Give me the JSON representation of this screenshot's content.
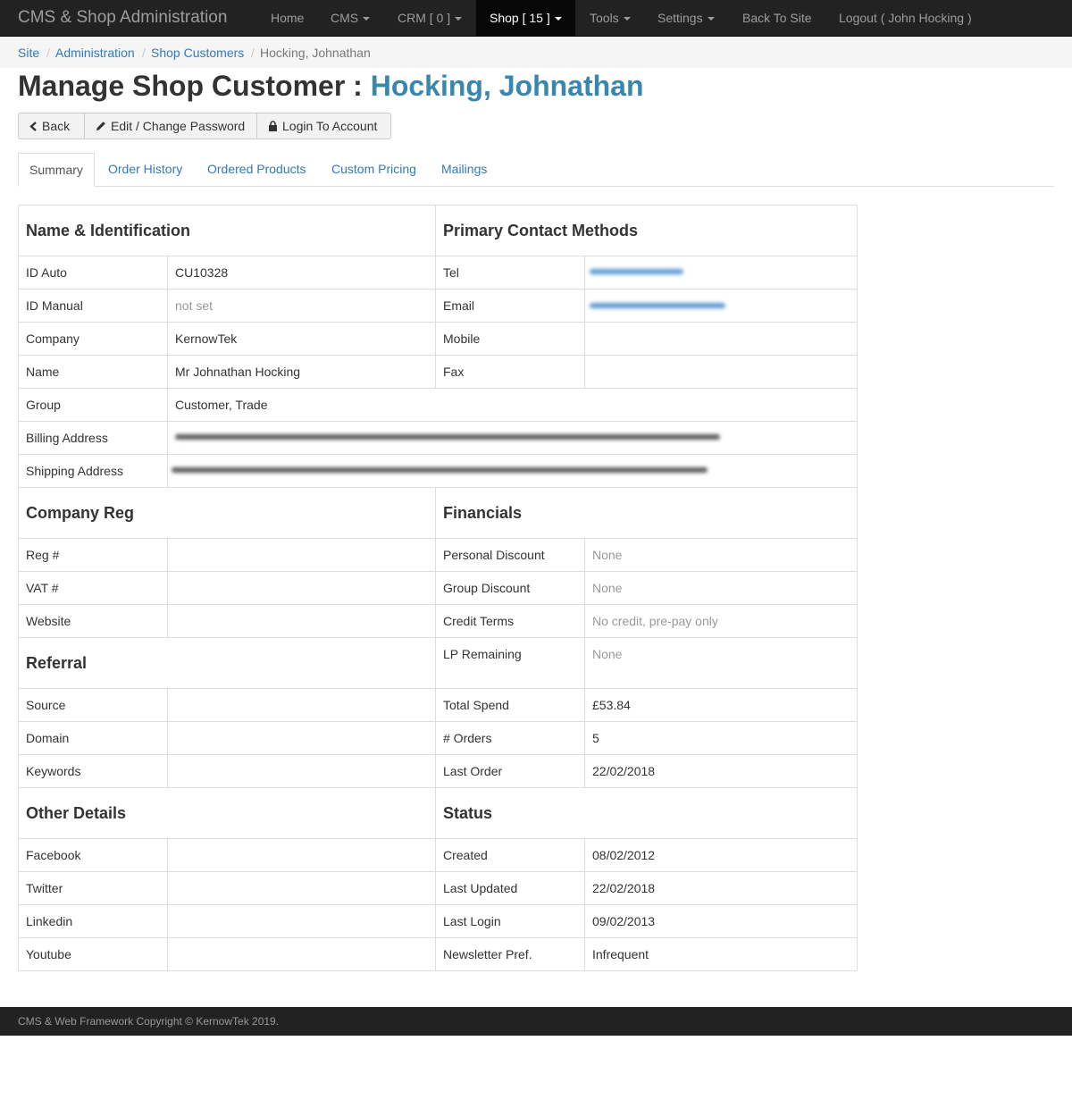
{
  "navbar": {
    "brand": "CMS & Shop Administration",
    "items": [
      "Home",
      "CMS",
      "CRM [ 0 ]",
      "Shop [ 15 ]",
      "Tools",
      "Settings",
      "Back To Site",
      "Logout ( John Hocking )"
    ]
  },
  "breadcrumb": {
    "separator": "/",
    "items": [
      "Site",
      "Administration",
      "Shop Customers",
      "Hocking, Johnathan"
    ]
  },
  "page": {
    "title_prefix": "Manage Shop Customer : ",
    "title_name": "Hocking, Johnathan"
  },
  "actions": {
    "back": "Back",
    "edit": "Edit / Change Password",
    "login": "Login To Account"
  },
  "tabs": [
    "Summary",
    "Order History",
    "Ordered Products",
    "Custom Pricing",
    "Mailings"
  ],
  "identification": {
    "heading": "Name & Identification",
    "id_auto_label": "ID Auto",
    "id_auto": "CU10328",
    "id_manual_label": "ID Manual",
    "id_manual": "not set",
    "company_label": "Company",
    "company": "KernowTek",
    "name_label": "Name",
    "name": "Mr Johnathan Hocking",
    "group_label": "Group",
    "group": "Customer, Trade",
    "billing_label": "Billing Address",
    "shipping_label": "Shipping Address"
  },
  "contact": {
    "heading": "Primary Contact Methods",
    "tel_label": "Tel",
    "email_label": "Email",
    "mobile_label": "Mobile",
    "fax_label": "Fax"
  },
  "company_reg": {
    "heading": "Company Reg",
    "reg_label": "Reg #",
    "vat_label": "VAT #",
    "website_label": "Website"
  },
  "financials": {
    "heading": "Financials",
    "personal_discount_label": "Personal Discount",
    "personal_discount": "None",
    "group_discount_label": "Group Discount",
    "group_discount": "None",
    "credit_terms_label": "Credit Terms",
    "credit_terms": "No credit, pre-pay only",
    "lp_remaining_label": "LP Remaining",
    "lp_remaining": "None",
    "total_spend_label": "Total Spend",
    "total_spend": "£53.84",
    "orders_label": "# Orders",
    "orders": "5",
    "last_order_label": "Last Order",
    "last_order": "22/02/2018"
  },
  "referral": {
    "heading": "Referral",
    "source_label": "Source",
    "domain_label": "Domain",
    "keywords_label": "Keywords"
  },
  "other": {
    "heading": "Other Details",
    "facebook_label": "Facebook",
    "twitter_label": "Twitter",
    "linkedin_label": "Linkedin",
    "youtube_label": "Youtube"
  },
  "status": {
    "heading": "Status",
    "created_label": "Created",
    "created": "08/02/2012",
    "last_updated_label": "Last Updated",
    "last_updated": "22/02/2018",
    "last_login_label": "Last Login",
    "last_login": "09/02/2013",
    "newsletter_label": "Newsletter Pref.",
    "newsletter": "Infrequent"
  },
  "footer": {
    "copyright": "CMS & Web Framework Copyright © KernowTek 2019."
  },
  "colors": {
    "navbar": "#222222",
    "link": "#337ab7",
    "accent": "#3a87ad",
    "muted": "#999999",
    "border": "#dddddd",
    "redacted_contact": "#5b9bd5",
    "redacted_address": "#555555"
  }
}
